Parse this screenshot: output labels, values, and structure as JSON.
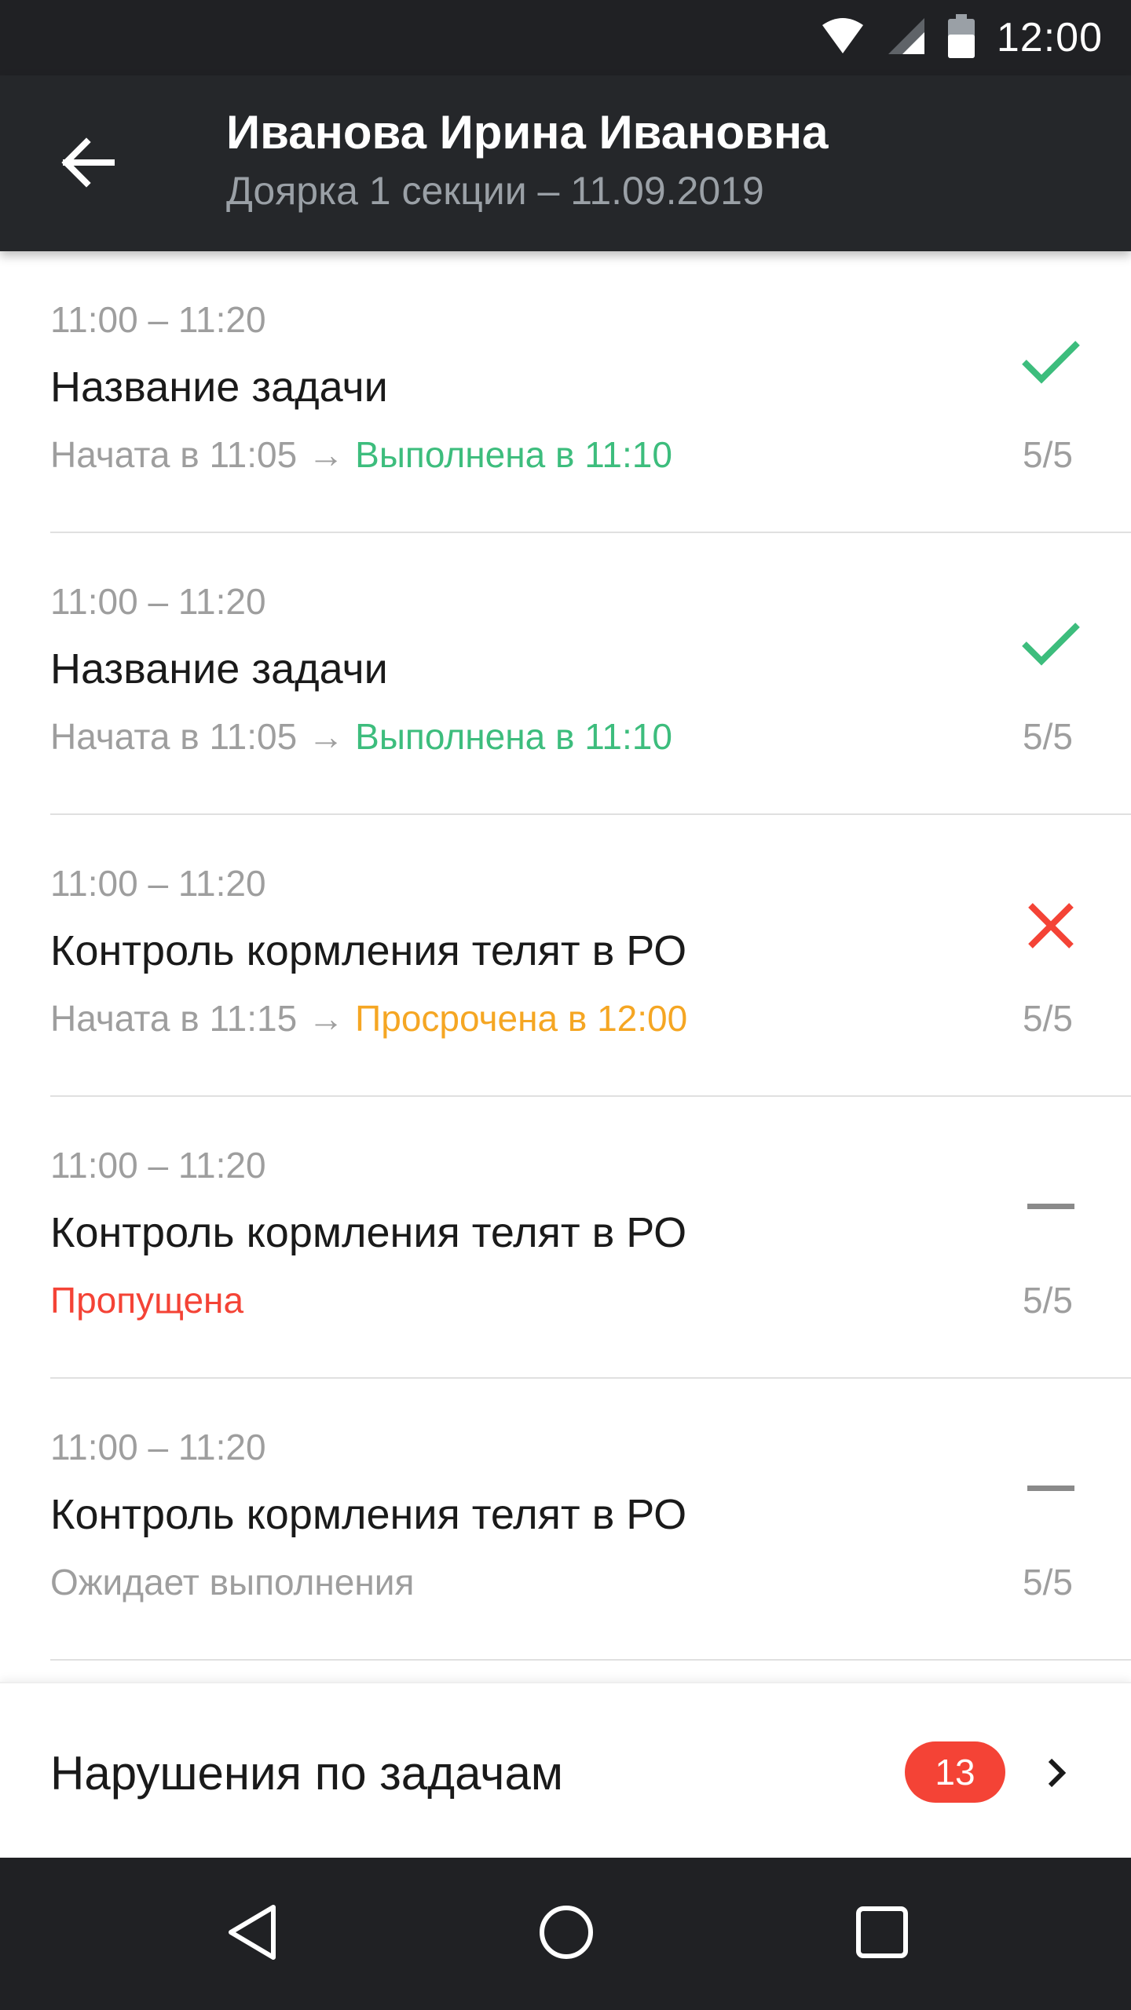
{
  "status_bar": {
    "time": "12:00",
    "icons": [
      "wifi-icon",
      "signal-icon",
      "battery-icon"
    ]
  },
  "app_bar": {
    "back_icon": "arrow-back-icon",
    "title": "Иванова Ирина Ивановна",
    "subtitle": "Доярка 1 секции – 11.09.2019"
  },
  "tasks": [
    {
      "time": "11:00 – 11:20",
      "name": "Название задачи",
      "started": "Начата в 11:05",
      "arrow": "→",
      "result": "Выполнена в 11:10",
      "result_color": "#3dbd7d",
      "icon": "check-icon",
      "count": "5/5"
    },
    {
      "time": "11:00 – 11:20",
      "name": "Название задачи",
      "started": "Начата в 11:05",
      "arrow": "→",
      "result": "Выполнена в 11:10",
      "result_color": "#3dbd7d",
      "icon": "check-icon",
      "count": "5/5"
    },
    {
      "time": "11:00 – 11:20",
      "name": "Контроль кормления телят в РО",
      "started": "Начата в 11:15",
      "arrow": "→",
      "result": "Просрочена в 12:00",
      "result_color": "#f5a623",
      "icon": "cross-icon",
      "count": "5/5"
    },
    {
      "time": "11:00 – 11:20",
      "name": "Контроль кормления телят в РО",
      "status": "Пропущена",
      "status_color": "#f44336",
      "icon": "dash-icon",
      "count": "5/5"
    },
    {
      "time": "11:00 – 11:20",
      "name": "Контроль кормления телят в РО",
      "status": "Ожидает выполнения",
      "status_color": "#9e9e9e",
      "icon": "dash-icon",
      "count": "5/5"
    }
  ],
  "violations": {
    "label": "Нарушения по задачам",
    "count": "13",
    "icon": "chevron-right-icon"
  },
  "nav_bar": {
    "icons": [
      "nav-back-icon",
      "nav-home-icon",
      "nav-recents-icon"
    ]
  },
  "colors": {
    "status_bar_bg": "#202124",
    "app_bar_bg": "#25272a",
    "green": "#3dbd7d",
    "orange": "#f5a623",
    "red": "#f44336",
    "grey": "#9e9e9e"
  }
}
